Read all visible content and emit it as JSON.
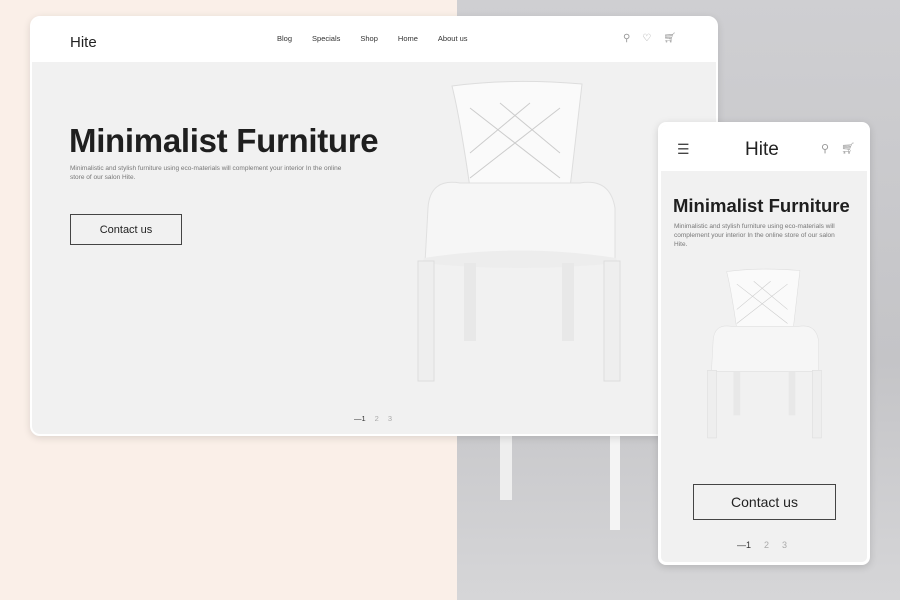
{
  "desktop": {
    "logo": "Hite",
    "nav": [
      "Blog",
      "Specials",
      "Shop",
      "Home",
      "About us"
    ],
    "icons": [
      "search-icon",
      "heart-icon",
      "cart-icon"
    ],
    "title": "Minimalist Furniture",
    "subtitle": "Minimalistic and stylish furniture using eco-materials will complement your interior In the online store of our salon Hite.",
    "cta": "Contact us",
    "pages": [
      "—1",
      "2",
      "3"
    ]
  },
  "mobile": {
    "logo": "Hite",
    "icons": [
      "menu-icon",
      "search-icon",
      "cart-icon"
    ],
    "title": "Minimalist Furniture",
    "subtitle": "Minimalistic and stylish furniture using eco-materials will complement your interior In the online store of our salon Hite.",
    "cta": "Contact us",
    "pages": [
      "—1",
      "2",
      "3"
    ]
  },
  "colors": {
    "left_background": "#faefe8",
    "right_background": "#c9c9cc",
    "hero_background": "#f1f1f1"
  }
}
